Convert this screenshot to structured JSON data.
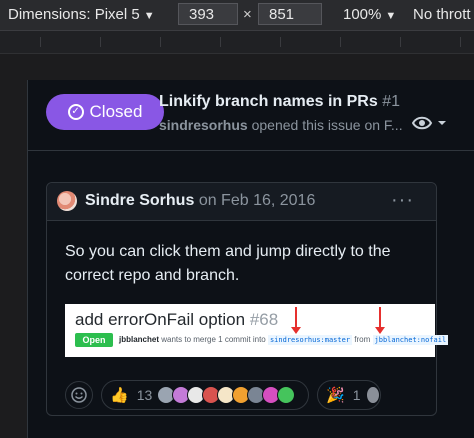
{
  "devtools": {
    "dimensions_label": "Dimensions: Pixel 5",
    "width": "393",
    "height": "851",
    "separator": "×",
    "zoom": "100%",
    "throttle": "No thrott"
  },
  "issue": {
    "status": "Closed",
    "title": "Linkify branch names in PRs",
    "number": "#1",
    "author": "sindresorhus",
    "meta_text": "opened this issue on F..."
  },
  "comment": {
    "author": "Sindre Sorhus",
    "date": "on Feb 16, 2016",
    "more": "···",
    "body": "So you can click them and jump directly to the correct repo and branch.",
    "embed": {
      "title": "add errorOnFail option",
      "number": "#68",
      "state": "Open",
      "user": "jbblanchet",
      "merge_text": "wants to merge 1 commit into",
      "base_branch": "sindresorhus:master",
      "from_text": "from",
      "head_branch": "jbblanchet:nofail"
    },
    "reactions": [
      {
        "emoji": "👍",
        "count": "13"
      },
      {
        "emoji": "🎉",
        "count": "1"
      }
    ]
  },
  "colors": {
    "closed_badge": "#8957e5",
    "open_badge": "#2cbe4e",
    "arrow": "#e6302e"
  }
}
